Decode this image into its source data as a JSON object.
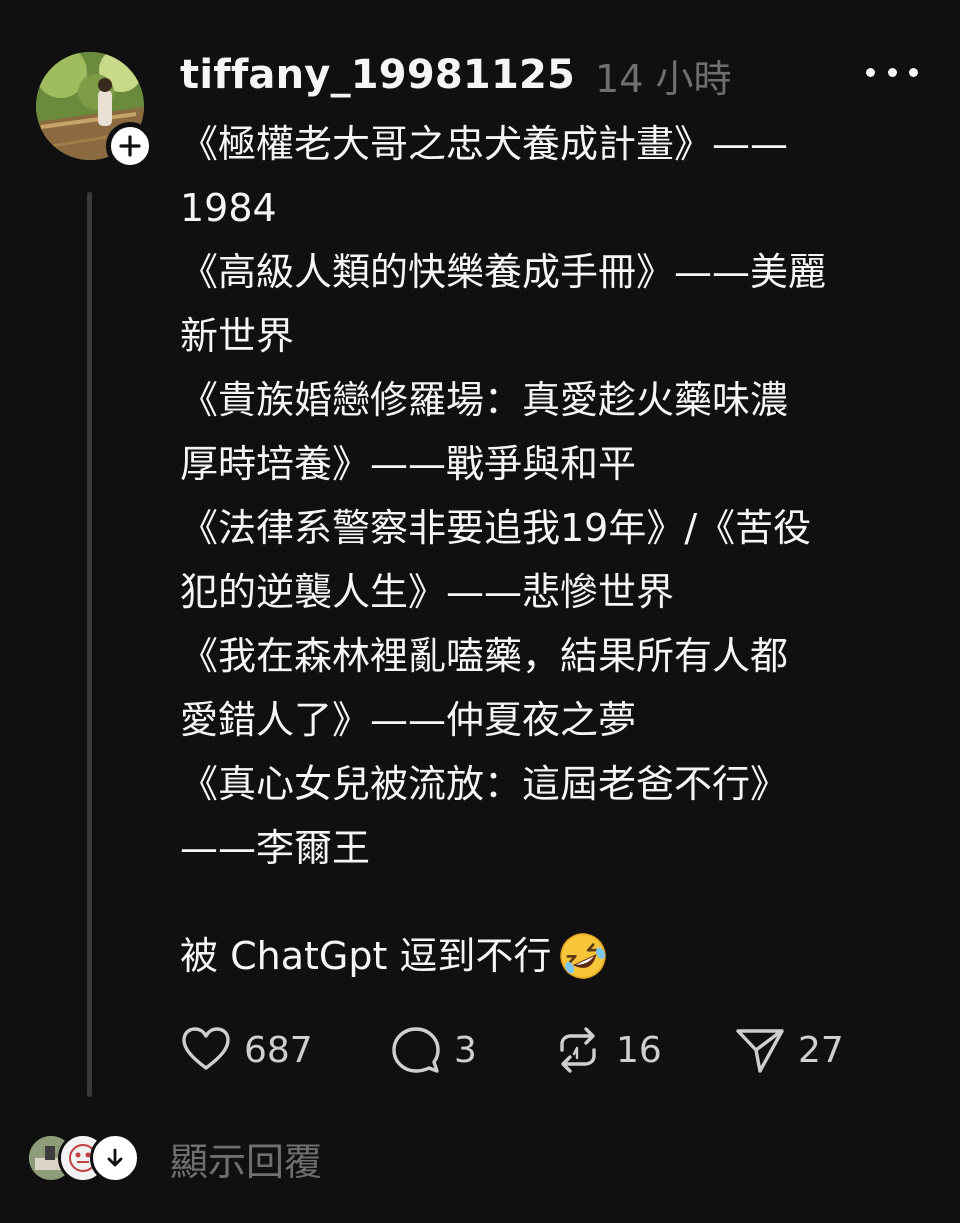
{
  "post": {
    "username": "tiffany_19981125",
    "timestamp": "14 小時",
    "lines": [
      "《極權老大哥之忠犬養成計畫》——",
      "1984",
      "《高級人類的快樂養成手冊》——美麗",
      "新世界",
      "《貴族婚戀修羅場：真愛趁火藥味濃",
      "厚時培養》——戰爭與和平",
      "《法律系警察非要追我19年》/《苦役",
      "犯的逆襲人生》——悲慘世界",
      "《我在森林裡亂嗑藥，結果所有人都",
      "愛錯人了》——仲夏夜之夢",
      "《真心女兒被流放：這屆老爸不行》",
      "——李爾王"
    ],
    "closing": "被 ChatGpt 逗到不行",
    "closing_emoji": "rolling-on-floor-laughing-emoji"
  },
  "actions": {
    "likes": "687",
    "comments": "3",
    "reposts": "16",
    "shares": "27"
  },
  "replies": {
    "label": "顯示回覆"
  },
  "icons": {
    "like": "heart-icon",
    "comment": "comment-bubble-icon",
    "repost": "repost-icon",
    "share": "send-icon",
    "more": "more-dots-icon",
    "follow": "plus-icon",
    "expand": "arrow-down-icon"
  },
  "colors": {
    "background": "#101010",
    "text": "#f3f5f7",
    "muted": "#6f6f6f"
  }
}
